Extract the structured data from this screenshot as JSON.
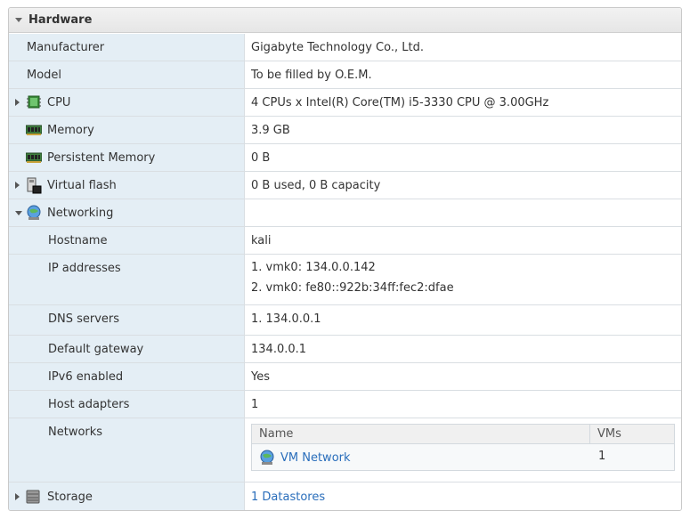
{
  "panel": {
    "title": "Hardware"
  },
  "rows": {
    "manufacturer": {
      "label": "Manufacturer",
      "value": "Gigabyte Technology Co., Ltd."
    },
    "model": {
      "label": "Model",
      "value": "To be filled by O.E.M."
    },
    "cpu": {
      "label": "CPU",
      "value": "4 CPUs x Intel(R) Core(TM) i5-3330 CPU @ 3.00GHz"
    },
    "memory": {
      "label": "Memory",
      "value": "3.9 GB"
    },
    "persistent_memory": {
      "label": "Persistent Memory",
      "value": "0 B"
    },
    "virtual_flash": {
      "label": "Virtual flash",
      "value": "0 B used, 0 B capacity"
    },
    "networking": {
      "label": "Networking",
      "value": ""
    },
    "hostname": {
      "label": "Hostname",
      "value": "kali"
    },
    "ip_addresses": {
      "label": "IP addresses",
      "values": [
        "1. vmk0: 134.0.0.142",
        "2. vmk0: fe80::922b:34ff:fec2:dfae"
      ]
    },
    "dns_servers": {
      "label": "DNS servers",
      "value": "1. 134.0.0.1"
    },
    "default_gateway": {
      "label": "Default gateway",
      "value": "134.0.0.1"
    },
    "ipv6_enabled": {
      "label": "IPv6 enabled",
      "value": "Yes"
    },
    "host_adapters": {
      "label": "Host adapters",
      "value": "1"
    },
    "networks": {
      "label": "Networks",
      "columns": {
        "name": "Name",
        "vms": "VMs"
      },
      "items": [
        {
          "name": "VM Network",
          "vms": "1"
        }
      ]
    },
    "storage": {
      "label": "Storage",
      "value": "1 Datastores"
    }
  },
  "icons": {
    "cpu": "cpu-chip-icon",
    "memory": "memory-module-icon",
    "persistent_memory": "memory-module-icon",
    "virtual_flash": "flash-device-icon",
    "networking": "network-globe-icon",
    "storage": "storage-disk-icon"
  },
  "colors": {
    "left_column_bg": "#e4eef5",
    "link": "#2a6ebb",
    "border": "#d9dee2"
  }
}
